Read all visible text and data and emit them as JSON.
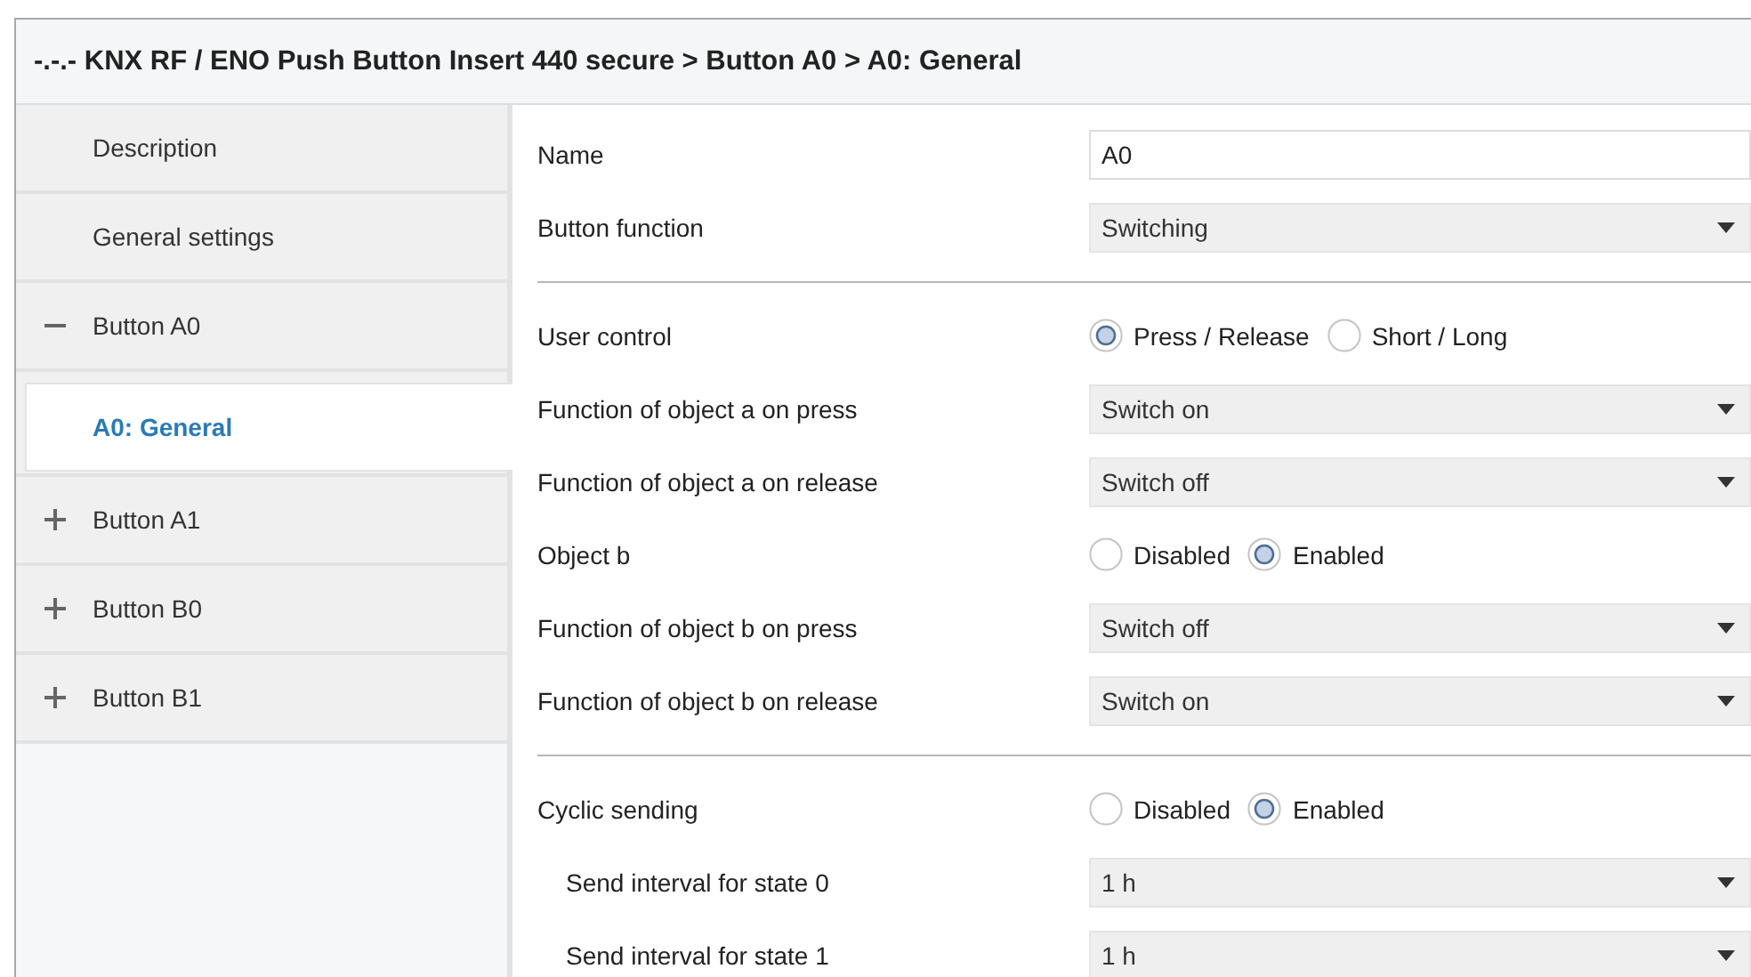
{
  "window": {
    "title": "-.-.- KNX RF / ENO Push Button Insert 440 secure > Button A0 > A0: General"
  },
  "sidebar": {
    "items": [
      {
        "label": "Description",
        "selected": false
      },
      {
        "label": "General settings",
        "selected": false
      },
      {
        "label": "Button A0",
        "selected": false,
        "expanded": true,
        "children": [
          {
            "label": "A0: General",
            "selected": true
          }
        ]
      },
      {
        "label": "Button A1",
        "selected": false,
        "expanded": false
      },
      {
        "label": "Button B0",
        "selected": false,
        "expanded": false
      },
      {
        "label": "Button B1",
        "selected": false,
        "expanded": false
      }
    ]
  },
  "parameter_groups": [
    [
      {
        "kind": "text",
        "label": "Name",
        "value": "A0"
      },
      {
        "kind": "dropdown",
        "label": "Button function",
        "value": "Switching"
      }
    ],
    [
      {
        "kind": "radio",
        "label": "User control",
        "options": [
          {
            "label": "Press / Release",
            "selected": true
          },
          {
            "label": "Short / Long",
            "selected": false
          }
        ]
      },
      {
        "kind": "dropdown",
        "label": "Function of object a on press",
        "value": "Switch on"
      },
      {
        "kind": "dropdown",
        "label": "Function of object a on release",
        "value": "Switch off"
      },
      {
        "kind": "radio",
        "label": "Object b",
        "options": [
          {
            "label": "Disabled",
            "selected": false
          },
          {
            "label": "Enabled",
            "selected": true
          }
        ]
      },
      {
        "kind": "dropdown",
        "label": "Function of object b on press",
        "value": "Switch off"
      },
      {
        "kind": "dropdown",
        "label": "Function of object b on release",
        "value": "Switch on"
      }
    ],
    [
      {
        "kind": "radio",
        "label": "Cyclic sending",
        "options": [
          {
            "label": "Disabled",
            "selected": false
          },
          {
            "label": "Enabled",
            "selected": true
          }
        ],
        "children": [
          {
            "kind": "dropdown",
            "label": "Send interval for state 0",
            "value": "1 h"
          },
          {
            "kind": "dropdown",
            "label": "Send interval for state 1",
            "value": "1 h"
          }
        ]
      }
    ]
  ]
}
